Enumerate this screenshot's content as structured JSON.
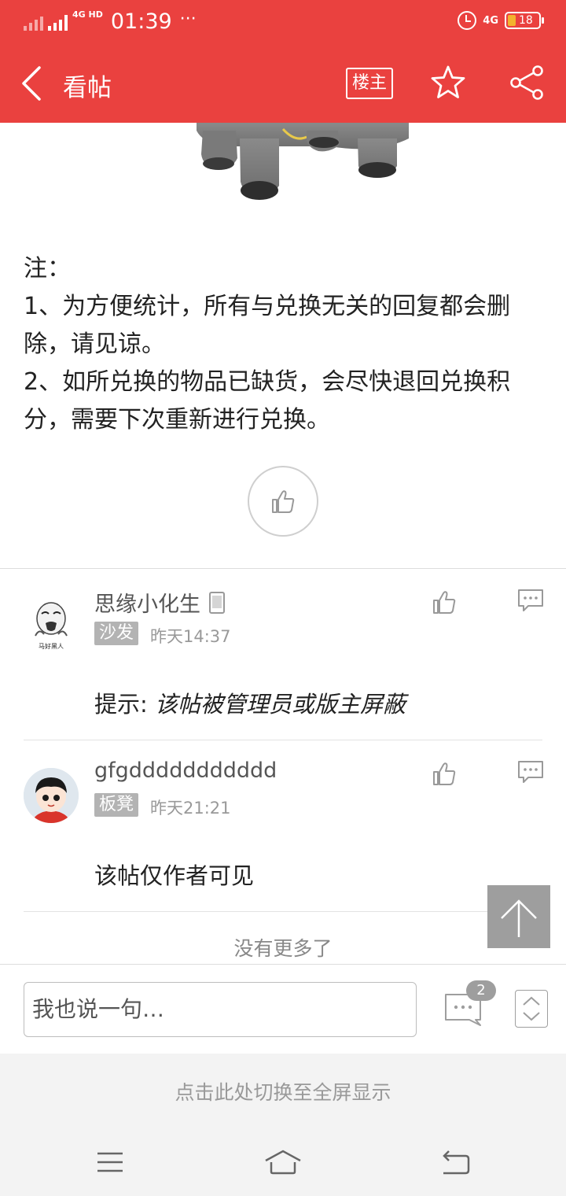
{
  "status_bar": {
    "network_left": "4G HD",
    "time": "01:39",
    "dots": "···",
    "network_right": "4G",
    "battery": "18"
  },
  "nav": {
    "title": "看帖",
    "owner_button": "楼主"
  },
  "post": {
    "lines": [
      "注：",
      "1、为方便统计，所有与兑换无关的回复都会删除，请见谅。",
      "2、如所兑换的物品已缺货，会尽快退回兑换积分，需要下次重新进行兑换。"
    ]
  },
  "comments": [
    {
      "user": "思缘小化生",
      "floor": "沙发",
      "time": "昨天14:37",
      "body_prefix": "提示: ",
      "body": "该帖被管理员或版主屏蔽",
      "avatar_caption": "马好黑人"
    },
    {
      "user": "gfgddddddddddd",
      "floor": "板凳",
      "time": "昨天21:21",
      "body_prefix": "",
      "body": "该帖仅作者可见"
    }
  ],
  "no_more": "没有更多了",
  "bottom": {
    "input_placeholder": "我也说一句…",
    "comment_count": "2"
  },
  "fullscreen_hint": "点击此处切换至全屏显示",
  "colors": {
    "brand": "#ea413f",
    "badge": "#b3b3b3"
  }
}
